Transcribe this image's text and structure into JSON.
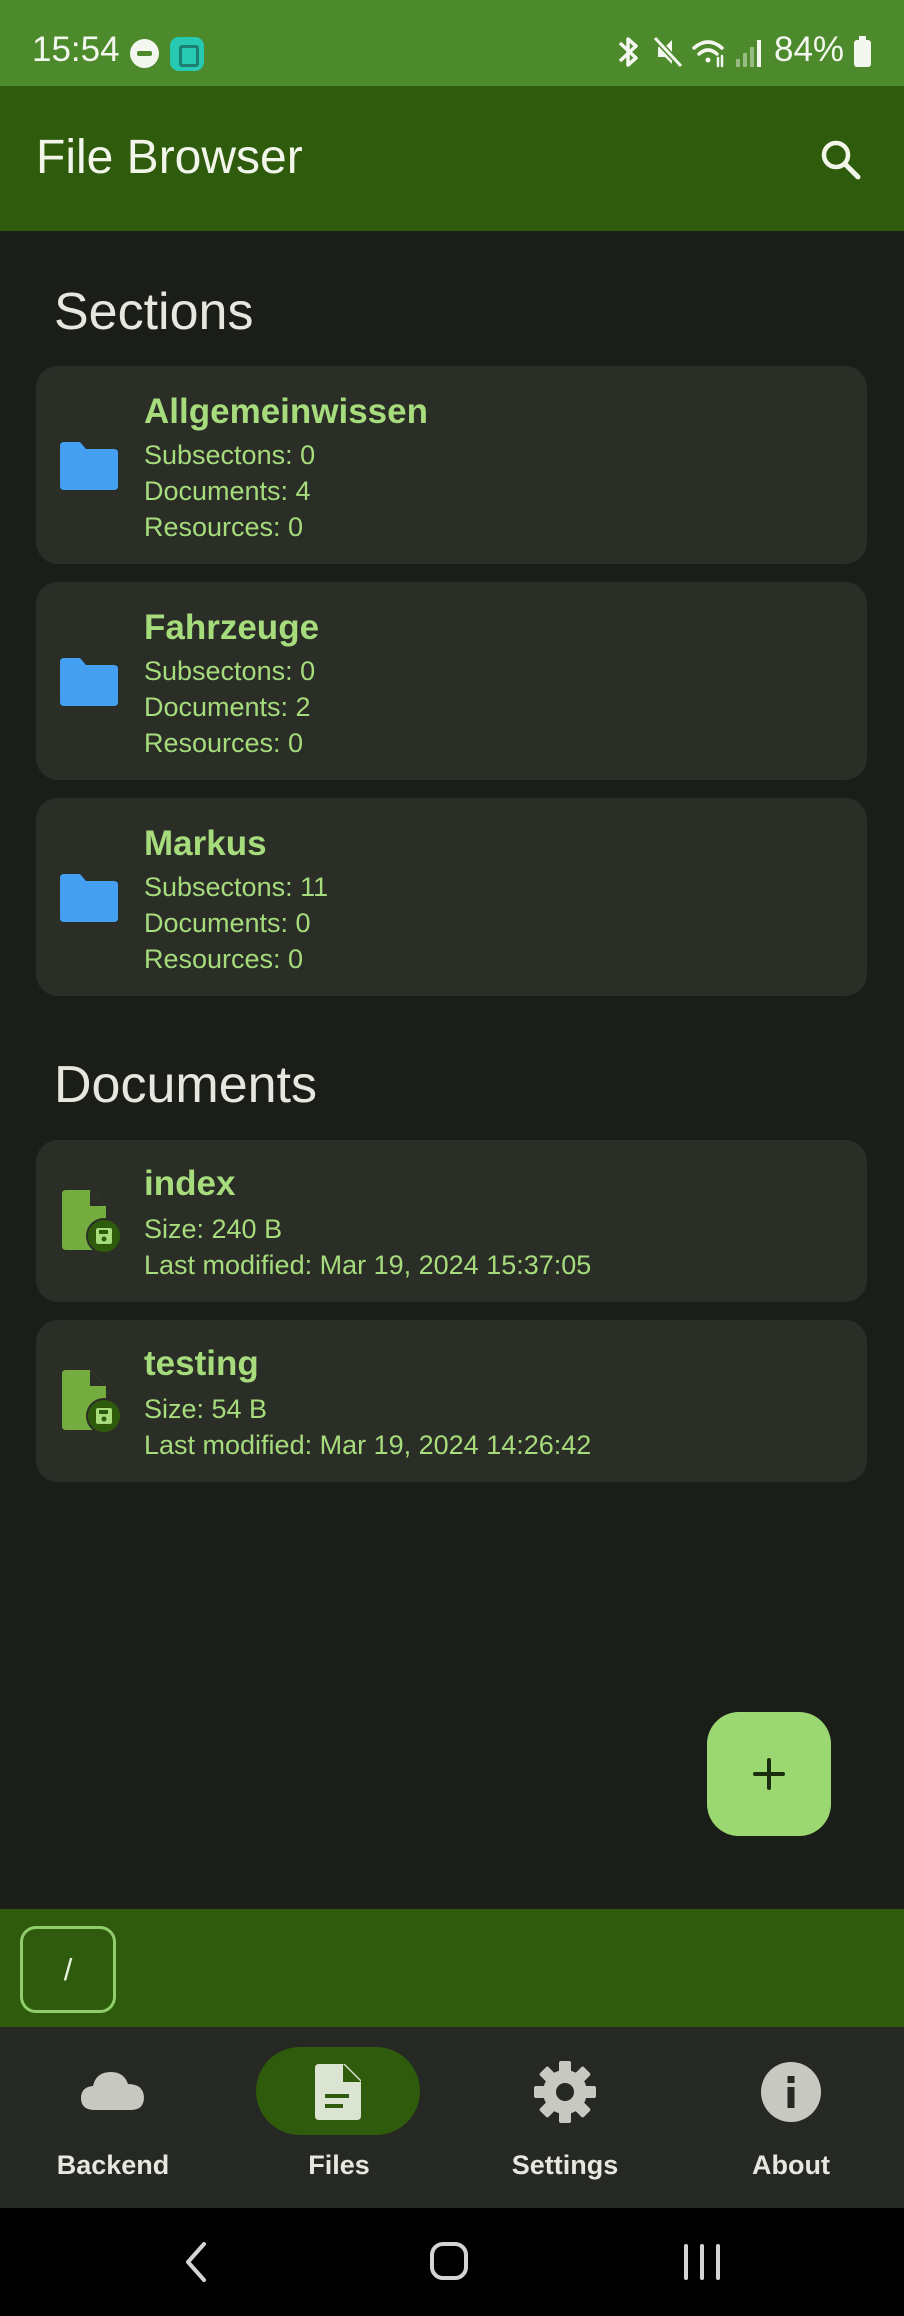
{
  "status_bar": {
    "time": "15:54",
    "battery": "84%",
    "icons": [
      "dnd-icon",
      "app-notification-icon",
      "bluetooth-icon",
      "mute-icon",
      "wifi-icon",
      "signal-icon",
      "battery-icon"
    ]
  },
  "app_bar": {
    "title": "File Browser",
    "search_icon": "search-icon"
  },
  "sections": {
    "heading": "Sections",
    "items": [
      {
        "name": "Allgemeinwissen",
        "subsections": "Subsectons: 0",
        "documents": "Documents: 4",
        "resources": "Resources: 0"
      },
      {
        "name": "Fahrzeuge",
        "subsections": "Subsectons: 0",
        "documents": "Documents: 2",
        "resources": "Resources: 0"
      },
      {
        "name": "Markus",
        "subsections": "Subsectons: 11",
        "documents": "Documents: 0",
        "resources": "Resources: 0"
      }
    ]
  },
  "documents": {
    "heading": "Documents",
    "items": [
      {
        "name": "index",
        "size": "Size: 240 B",
        "modified": "Last modified: Mar 19, 2024 15:37:05"
      },
      {
        "name": "testing",
        "size": "Size: 54 B",
        "modified": "Last modified: Mar 19, 2024 14:26:42"
      }
    ]
  },
  "fab": {
    "icon": "plus-icon"
  },
  "path_bar": {
    "path": "/"
  },
  "bottom_nav": {
    "items": [
      {
        "label": "Backend",
        "icon": "cloud-icon",
        "active": false
      },
      {
        "label": "Files",
        "icon": "file-icon",
        "active": true
      },
      {
        "label": "Settings",
        "icon": "gear-icon",
        "active": false
      },
      {
        "label": "About",
        "icon": "info-icon",
        "active": false
      }
    ]
  },
  "system_nav": {
    "icons": [
      "back-icon",
      "home-icon",
      "recents-icon"
    ]
  },
  "colors": {
    "status_bar": "#4d8a2c",
    "app_bar": "#2f5b0d",
    "background": "#1b1d19",
    "card": "#2a2e27",
    "accent_text": "#a6dc7c",
    "folder": "#45a0f2",
    "fab": "#9bd872"
  }
}
